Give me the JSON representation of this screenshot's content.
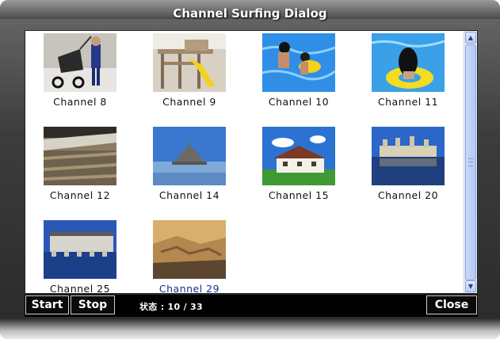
{
  "window": {
    "title": "Channel Surfing Dialog"
  },
  "channels": [
    {
      "label": "Channel 8",
      "thumbnail": "child-with-stroller"
    },
    {
      "label": "Channel 9",
      "thumbnail": "playground-slide"
    },
    {
      "label": "Channel 10",
      "thumbnail": "kids-in-pool"
    },
    {
      "label": "Channel 11",
      "thumbnail": "girl-on-pool-float"
    },
    {
      "label": "Channel 12",
      "thumbnail": "stadium-crowd"
    },
    {
      "label": "Channel 14",
      "thumbnail": "island-abbey"
    },
    {
      "label": "Channel 15",
      "thumbnail": "cottage-house"
    },
    {
      "label": "Channel 20",
      "thumbnail": "chateau-reflection"
    },
    {
      "label": "Channel 25",
      "thumbnail": "chateau-over-river"
    },
    {
      "label": "Channel 29",
      "thumbnail": "canyon-cliffs"
    }
  ],
  "toolbar": {
    "start_label": "Start",
    "stop_label": "Stop",
    "status_text": "状态 : 10 / 33",
    "close_label": "Close"
  },
  "scrollbar": {
    "up_icon": "arrow-up-icon",
    "down_icon": "arrow-down-icon"
  }
}
